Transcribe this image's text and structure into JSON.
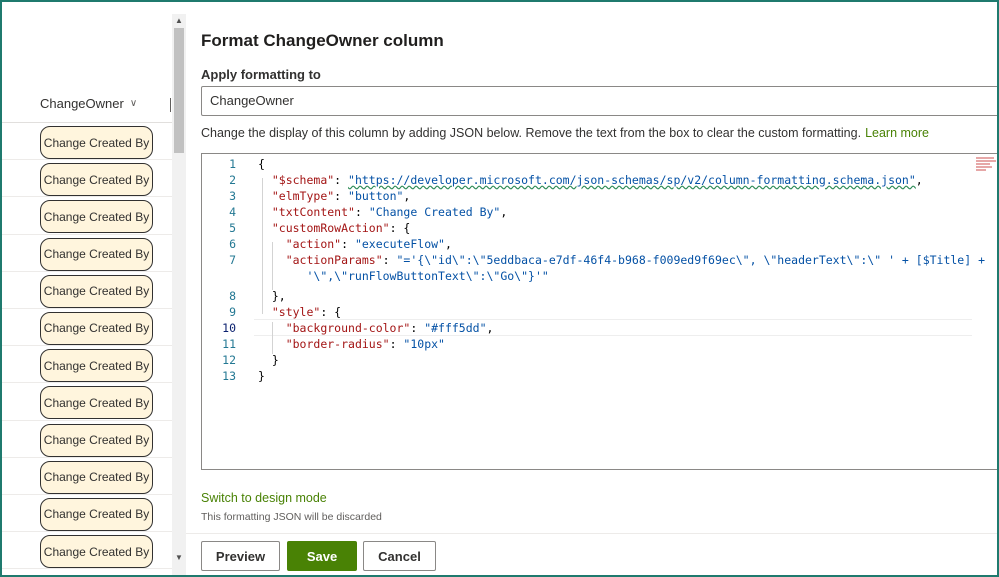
{
  "list": {
    "column_header": "ChangeOwner",
    "cell_button_label": "Change Created By",
    "rows": [
      "Change Created By",
      "Change Created By",
      "Change Created By",
      "Change Created By",
      "Change Created By",
      "Change Created By",
      "Change Created By",
      "Change Created By",
      "Change Created By",
      "Change Created By",
      "Change Created By",
      "Change Created By"
    ]
  },
  "panel": {
    "title": "Format ChangeOwner column",
    "apply_label": "Apply formatting to",
    "apply_value": "ChangeOwner",
    "description": "Change the display of this column by adding JSON below. Remove the text from the box to clear the custom formatting.",
    "learn_more": "Learn more",
    "switch_link": "Switch to design mode",
    "discard_note": "This formatting JSON will be discarded",
    "buttons": {
      "preview": "Preview",
      "save": "Save",
      "cancel": "Cancel"
    }
  },
  "editor": {
    "line_numbers": [
      "1",
      "2",
      "3",
      "4",
      "5",
      "6",
      "7",
      "",
      "8",
      "9",
      "10",
      "11",
      "12",
      "13"
    ],
    "tokens": {
      "schema_key": "\"$schema\"",
      "schema_val": "\"https://developer.microsoft.com/json-schemas/sp/v2/column-formatting.schema.json\"",
      "elm_key": "\"elmType\"",
      "elm_val": "\"button\"",
      "txt_key": "\"txtContent\"",
      "txt_val": "\"Change Created By\"",
      "cra_key": "\"customRowAction\"",
      "action_key": "\"action\"",
      "action_val": "\"executeFlow\"",
      "ap_key": "\"actionParams\"",
      "ap_val_1": "\"='{\\\"id\\\":\\\"5eddbaca-e7df-46f4-b968-f009ed9f69ec\\\", \\\"headerText\\\":\\\" ' + [$Title] +",
      "ap_val_2": "'\\\",\\\"runFlowButtonText\\\":\\\"Go\\\"}'\"",
      "style_key": "\"style\"",
      "bg_key": "\"background-color\"",
      "bg_val": "\"#fff5dd\"",
      "br_key": "\"border-radius\"",
      "br_val": "\"10px\""
    }
  },
  "colors": {
    "accent_green": "#498205",
    "cell_bg": "#fff5dd",
    "frame": "#1f7a6e"
  }
}
